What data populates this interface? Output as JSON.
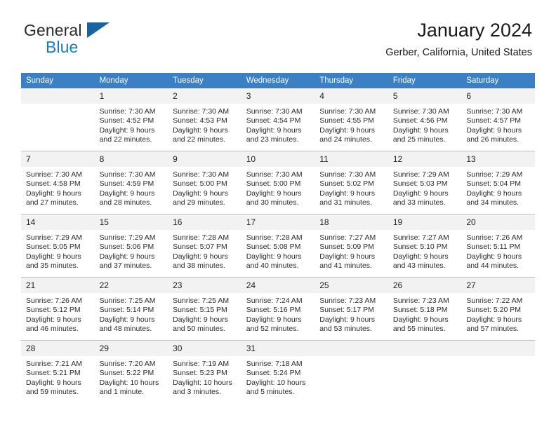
{
  "brand": {
    "name_part1": "General",
    "name_part2": "Blue",
    "flag_icon": "blue-flag-icon",
    "accent_color": "#2077c4"
  },
  "header": {
    "title": "January 2024",
    "subtitle": "Gerber, California, United States"
  },
  "calendar": {
    "header_bg": "#3b7fc4",
    "daynum_bg": "#f2f2f2",
    "weekday_headers": [
      "Sunday",
      "Monday",
      "Tuesday",
      "Wednesday",
      "Thursday",
      "Friday",
      "Saturday"
    ],
    "weeks": [
      [
        {
          "day": "",
          "lines": [
            "",
            "",
            "",
            ""
          ]
        },
        {
          "day": "1",
          "lines": [
            "Sunrise: 7:30 AM",
            "Sunset: 4:52 PM",
            "Daylight: 9 hours",
            "and 22 minutes."
          ]
        },
        {
          "day": "2",
          "lines": [
            "Sunrise: 7:30 AM",
            "Sunset: 4:53 PM",
            "Daylight: 9 hours",
            "and 22 minutes."
          ]
        },
        {
          "day": "3",
          "lines": [
            "Sunrise: 7:30 AM",
            "Sunset: 4:54 PM",
            "Daylight: 9 hours",
            "and 23 minutes."
          ]
        },
        {
          "day": "4",
          "lines": [
            "Sunrise: 7:30 AM",
            "Sunset: 4:55 PM",
            "Daylight: 9 hours",
            "and 24 minutes."
          ]
        },
        {
          "day": "5",
          "lines": [
            "Sunrise: 7:30 AM",
            "Sunset: 4:56 PM",
            "Daylight: 9 hours",
            "and 25 minutes."
          ]
        },
        {
          "day": "6",
          "lines": [
            "Sunrise: 7:30 AM",
            "Sunset: 4:57 PM",
            "Daylight: 9 hours",
            "and 26 minutes."
          ]
        }
      ],
      [
        {
          "day": "7",
          "lines": [
            "Sunrise: 7:30 AM",
            "Sunset: 4:58 PM",
            "Daylight: 9 hours",
            "and 27 minutes."
          ]
        },
        {
          "day": "8",
          "lines": [
            "Sunrise: 7:30 AM",
            "Sunset: 4:59 PM",
            "Daylight: 9 hours",
            "and 28 minutes."
          ]
        },
        {
          "day": "9",
          "lines": [
            "Sunrise: 7:30 AM",
            "Sunset: 5:00 PM",
            "Daylight: 9 hours",
            "and 29 minutes."
          ]
        },
        {
          "day": "10",
          "lines": [
            "Sunrise: 7:30 AM",
            "Sunset: 5:00 PM",
            "Daylight: 9 hours",
            "and 30 minutes."
          ]
        },
        {
          "day": "11",
          "lines": [
            "Sunrise: 7:30 AM",
            "Sunset: 5:02 PM",
            "Daylight: 9 hours",
            "and 31 minutes."
          ]
        },
        {
          "day": "12",
          "lines": [
            "Sunrise: 7:29 AM",
            "Sunset: 5:03 PM",
            "Daylight: 9 hours",
            "and 33 minutes."
          ]
        },
        {
          "day": "13",
          "lines": [
            "Sunrise: 7:29 AM",
            "Sunset: 5:04 PM",
            "Daylight: 9 hours",
            "and 34 minutes."
          ]
        }
      ],
      [
        {
          "day": "14",
          "lines": [
            "Sunrise: 7:29 AM",
            "Sunset: 5:05 PM",
            "Daylight: 9 hours",
            "and 35 minutes."
          ]
        },
        {
          "day": "15",
          "lines": [
            "Sunrise: 7:29 AM",
            "Sunset: 5:06 PM",
            "Daylight: 9 hours",
            "and 37 minutes."
          ]
        },
        {
          "day": "16",
          "lines": [
            "Sunrise: 7:28 AM",
            "Sunset: 5:07 PM",
            "Daylight: 9 hours",
            "and 38 minutes."
          ]
        },
        {
          "day": "17",
          "lines": [
            "Sunrise: 7:28 AM",
            "Sunset: 5:08 PM",
            "Daylight: 9 hours",
            "and 40 minutes."
          ]
        },
        {
          "day": "18",
          "lines": [
            "Sunrise: 7:27 AM",
            "Sunset: 5:09 PM",
            "Daylight: 9 hours",
            "and 41 minutes."
          ]
        },
        {
          "day": "19",
          "lines": [
            "Sunrise: 7:27 AM",
            "Sunset: 5:10 PM",
            "Daylight: 9 hours",
            "and 43 minutes."
          ]
        },
        {
          "day": "20",
          "lines": [
            "Sunrise: 7:26 AM",
            "Sunset: 5:11 PM",
            "Daylight: 9 hours",
            "and 44 minutes."
          ]
        }
      ],
      [
        {
          "day": "21",
          "lines": [
            "Sunrise: 7:26 AM",
            "Sunset: 5:12 PM",
            "Daylight: 9 hours",
            "and 46 minutes."
          ]
        },
        {
          "day": "22",
          "lines": [
            "Sunrise: 7:25 AM",
            "Sunset: 5:14 PM",
            "Daylight: 9 hours",
            "and 48 minutes."
          ]
        },
        {
          "day": "23",
          "lines": [
            "Sunrise: 7:25 AM",
            "Sunset: 5:15 PM",
            "Daylight: 9 hours",
            "and 50 minutes."
          ]
        },
        {
          "day": "24",
          "lines": [
            "Sunrise: 7:24 AM",
            "Sunset: 5:16 PM",
            "Daylight: 9 hours",
            "and 52 minutes."
          ]
        },
        {
          "day": "25",
          "lines": [
            "Sunrise: 7:23 AM",
            "Sunset: 5:17 PM",
            "Daylight: 9 hours",
            "and 53 minutes."
          ]
        },
        {
          "day": "26",
          "lines": [
            "Sunrise: 7:23 AM",
            "Sunset: 5:18 PM",
            "Daylight: 9 hours",
            "and 55 minutes."
          ]
        },
        {
          "day": "27",
          "lines": [
            "Sunrise: 7:22 AM",
            "Sunset: 5:20 PM",
            "Daylight: 9 hours",
            "and 57 minutes."
          ]
        }
      ],
      [
        {
          "day": "28",
          "lines": [
            "Sunrise: 7:21 AM",
            "Sunset: 5:21 PM",
            "Daylight: 9 hours",
            "and 59 minutes."
          ]
        },
        {
          "day": "29",
          "lines": [
            "Sunrise: 7:20 AM",
            "Sunset: 5:22 PM",
            "Daylight: 10 hours",
            "and 1 minute."
          ]
        },
        {
          "day": "30",
          "lines": [
            "Sunrise: 7:19 AM",
            "Sunset: 5:23 PM",
            "Daylight: 10 hours",
            "and 3 minutes."
          ]
        },
        {
          "day": "31",
          "lines": [
            "Sunrise: 7:18 AM",
            "Sunset: 5:24 PM",
            "Daylight: 10 hours",
            "and 5 minutes."
          ]
        },
        {
          "day": "",
          "lines": [
            "",
            "",
            "",
            ""
          ]
        },
        {
          "day": "",
          "lines": [
            "",
            "",
            "",
            ""
          ]
        },
        {
          "day": "",
          "lines": [
            "",
            "",
            "",
            ""
          ]
        }
      ]
    ]
  }
}
